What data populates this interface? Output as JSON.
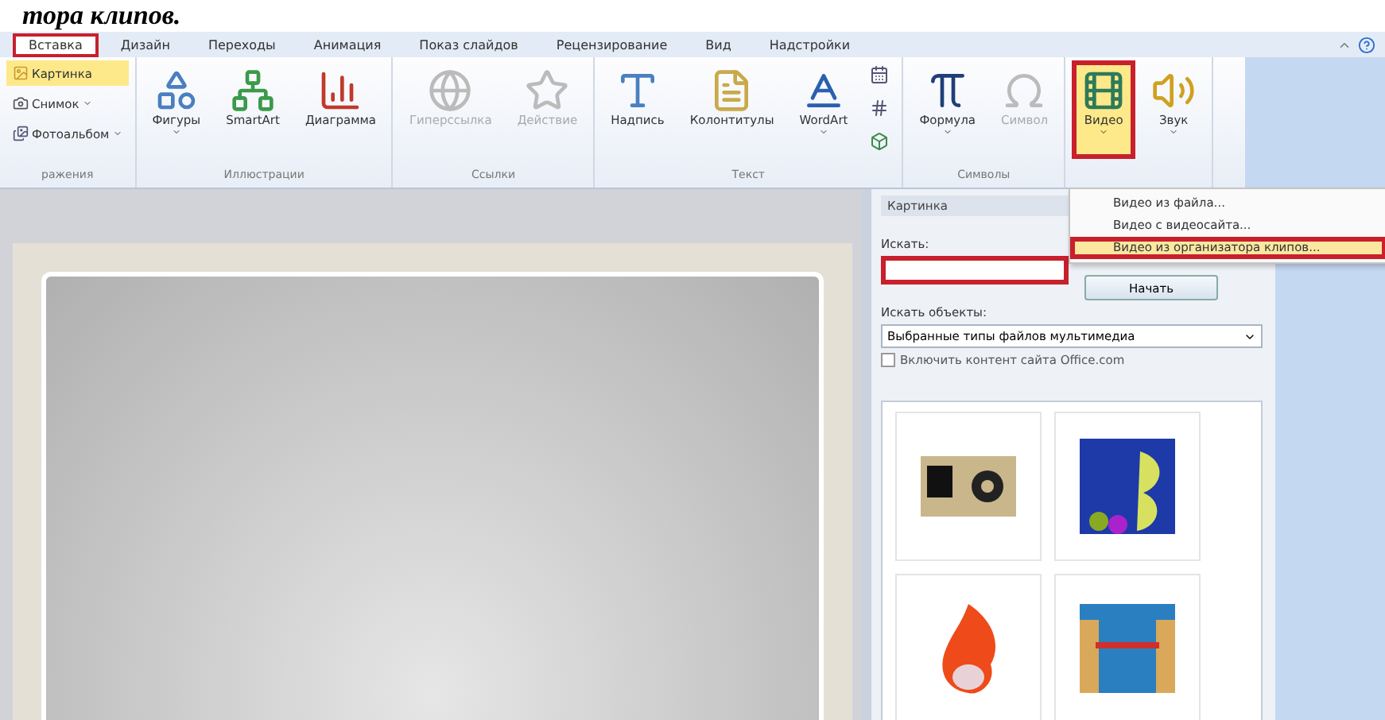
{
  "caption": "тора клипов.",
  "tabs": [
    {
      "label": "Вставка",
      "selected": true,
      "outlined": true
    },
    {
      "label": "Дизайн",
      "selected": false,
      "outlined": false
    },
    {
      "label": "Переходы",
      "selected": false,
      "outlined": false
    },
    {
      "label": "Анимация",
      "selected": false,
      "outlined": false
    },
    {
      "label": "Показ слайдов",
      "selected": false,
      "outlined": false
    },
    {
      "label": "Рецензирование",
      "selected": false,
      "outlined": false
    },
    {
      "label": "Вид",
      "selected": false,
      "outlined": false
    },
    {
      "label": "Надстройки",
      "selected": false,
      "outlined": false
    }
  ],
  "ribbon_groups": [
    {
      "label": "ражения",
      "items": [
        {
          "kind": "small",
          "label": "Картинка",
          "highlighted": true,
          "disabled": false,
          "outlined": false,
          "dropdown": false
        },
        {
          "kind": "small",
          "label": "Снимок",
          "highlighted": false,
          "disabled": false,
          "outlined": false,
          "dropdown": true
        },
        {
          "kind": "small",
          "label": "Фотоальбом",
          "highlighted": false,
          "disabled": false,
          "outlined": false,
          "dropdown": true
        }
      ]
    },
    {
      "label": "Иллюстрации",
      "items": [
        {
          "kind": "large",
          "label": "Фигуры",
          "highlighted": false,
          "disabled": false,
          "outlined": false,
          "dropdown": true
        },
        {
          "kind": "large",
          "label": "SmartArt",
          "highlighted": false,
          "disabled": false,
          "outlined": false,
          "dropdown": false
        },
        {
          "kind": "large",
          "label": "Диаграмма",
          "highlighted": false,
          "disabled": false,
          "outlined": false,
          "dropdown": false
        }
      ]
    },
    {
      "label": "Ссылки",
      "items": [
        {
          "kind": "large",
          "label": "Гиперссылка",
          "highlighted": false,
          "disabled": true,
          "outlined": false,
          "dropdown": false
        },
        {
          "kind": "large",
          "label": "Действие",
          "highlighted": false,
          "disabled": true,
          "outlined": false,
          "dropdown": false
        }
      ]
    },
    {
      "label": "Текст",
      "items": [
        {
          "kind": "large",
          "label": "Надпись",
          "highlighted": false,
          "disabled": false,
          "outlined": false,
          "dropdown": false
        },
        {
          "kind": "large",
          "label": "Колонтитулы",
          "highlighted": false,
          "disabled": false,
          "outlined": false,
          "dropdown": false
        },
        {
          "kind": "large",
          "label": "WordArt",
          "highlighted": false,
          "disabled": false,
          "outlined": false,
          "dropdown": true
        },
        {
          "kind": "mini",
          "highlighted": false,
          "disabled": false,
          "outlined": false,
          "dropdown": false
        },
        {
          "kind": "mini",
          "highlighted": false,
          "disabled": false,
          "outlined": false,
          "dropdown": false
        },
        {
          "kind": "mini",
          "highlighted": false,
          "disabled": false,
          "outlined": false,
          "dropdown": false
        }
      ]
    },
    {
      "label": "Символы",
      "items": [
        {
          "kind": "large",
          "label": "Формула",
          "highlighted": false,
          "disabled": false,
          "outlined": false,
          "dropdown": true
        },
        {
          "kind": "large",
          "label": "Символ",
          "highlighted": false,
          "disabled": true,
          "outlined": false,
          "dropdown": false
        }
      ]
    },
    {
      "items": [
        {
          "kind": "large",
          "label": "Видео",
          "highlighted": true,
          "disabled": false,
          "outlined": true,
          "dropdown": true
        },
        {
          "kind": "large",
          "label": "Звук",
          "highlighted": false,
          "disabled": false,
          "outlined": false,
          "dropdown": true
        }
      ]
    }
  ],
  "video_menu": [
    {
      "label": "Видео из файла...",
      "selected": false,
      "outlined": false
    },
    {
      "label": "Видео с видеосайта...",
      "selected": false,
      "outlined": false
    },
    {
      "label": "Видео из организатора клипов...",
      "selected": true,
      "outlined": true
    }
  ],
  "clip_pane": {
    "title": "Картинка",
    "search_label": "Искать:",
    "search_value_outlined": true,
    "search_button": "Начать",
    "objects_label": "Искать объекты:",
    "objects_value": "Выбранные типы файлов мультимедиа",
    "office_checkbox": {
      "label": "Включить контент сайта Office.com",
      "checked": false
    },
    "results": [
      {
        "kind": "camera"
      },
      {
        "kind": "money"
      },
      {
        "kind": "fire"
      },
      {
        "kind": "stage"
      }
    ]
  }
}
